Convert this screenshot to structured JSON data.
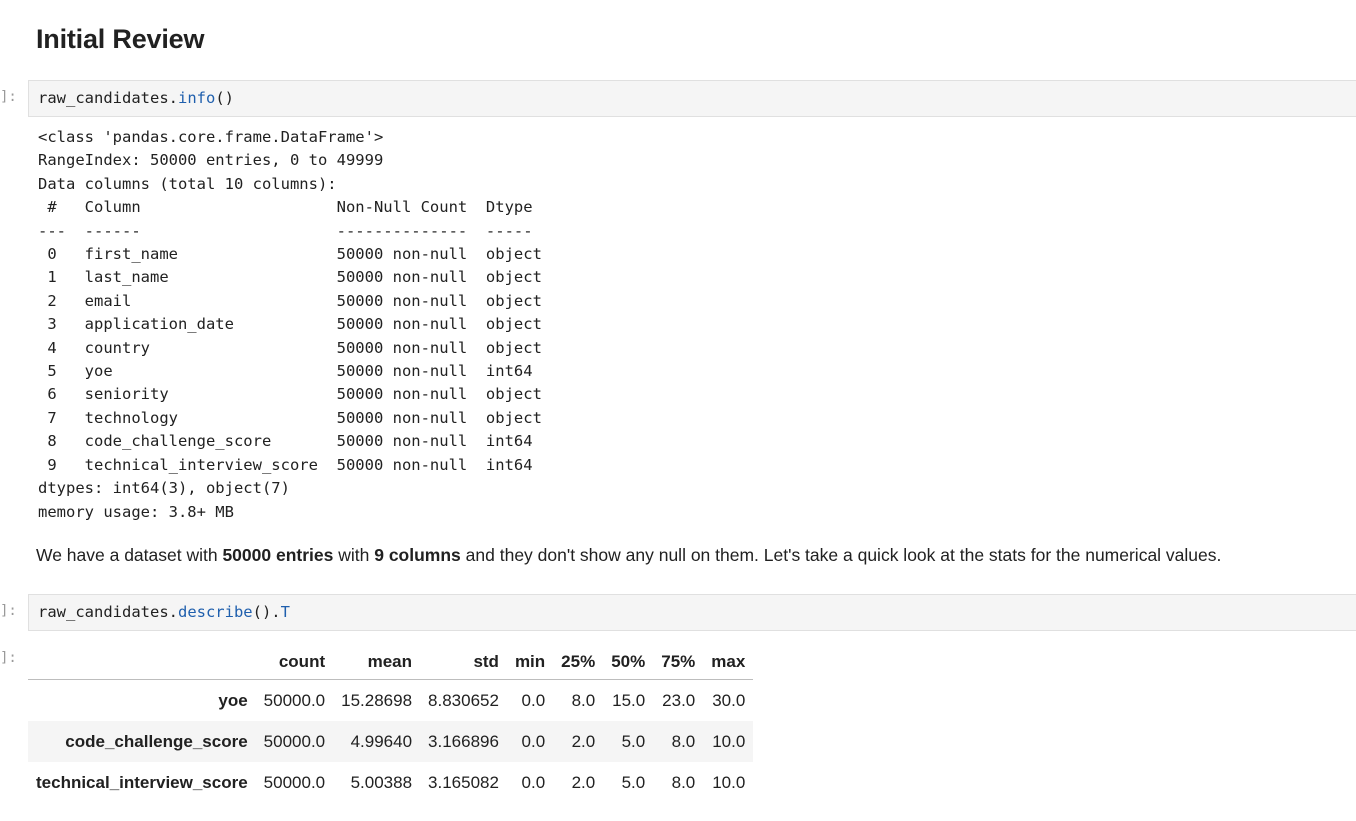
{
  "heading": "Initial Review",
  "cell1": {
    "prompt": "]:",
    "code_obj": "raw_candidates.",
    "code_fn": "info",
    "code_tail": "()"
  },
  "cell1_output": {
    "lines": [
      "<class 'pandas.core.frame.DataFrame'>",
      "RangeIndex: 50000 entries, 0 to 49999",
      "Data columns (total 10 columns):",
      " #   Column                     Non-Null Count  Dtype ",
      "---  ------                     --------------  ----- ",
      " 0   first_name                 50000 non-null  object",
      " 1   last_name                  50000 non-null  object",
      " 2   email                      50000 non-null  object",
      " 3   application_date           50000 non-null  object",
      " 4   country                    50000 non-null  object",
      " 5   yoe                        50000 non-null  int64 ",
      " 6   seniority                  50000 non-null  object",
      " 7   technology                 50000 non-null  object",
      " 8   code_challenge_score       50000 non-null  int64 ",
      " 9   technical_interview_score  50000 non-null  int64 ",
      "dtypes: int64(3), object(7)",
      "memory usage: 3.8+ MB"
    ]
  },
  "markdown": {
    "t1": "We have a dataset with ",
    "b1": "50000 entries",
    "t2": " with ",
    "b2": "9 columns",
    "t3": " and they don't show any null on them. Let's take a quick look at the stats for the numerical values."
  },
  "cell2": {
    "prompt": "]:",
    "code_obj": "raw_candidates.",
    "code_fn": "describe",
    "code_mid": "().",
    "code_attr": "T"
  },
  "cell2_output": {
    "prompt": "]:",
    "columns": [
      "count",
      "mean",
      "std",
      "min",
      "25%",
      "50%",
      "75%",
      "max"
    ],
    "rows": [
      {
        "index": "yoe",
        "values": [
          "50000.0",
          "15.28698",
          "8.830652",
          "0.0",
          "8.0",
          "15.0",
          "23.0",
          "30.0"
        ]
      },
      {
        "index": "code_challenge_score",
        "values": [
          "50000.0",
          "4.99640",
          "3.166896",
          "0.0",
          "2.0",
          "5.0",
          "8.0",
          "10.0"
        ]
      },
      {
        "index": "technical_interview_score",
        "values": [
          "50000.0",
          "5.00388",
          "3.165082",
          "0.0",
          "2.0",
          "5.0",
          "8.0",
          "10.0"
        ]
      }
    ]
  }
}
